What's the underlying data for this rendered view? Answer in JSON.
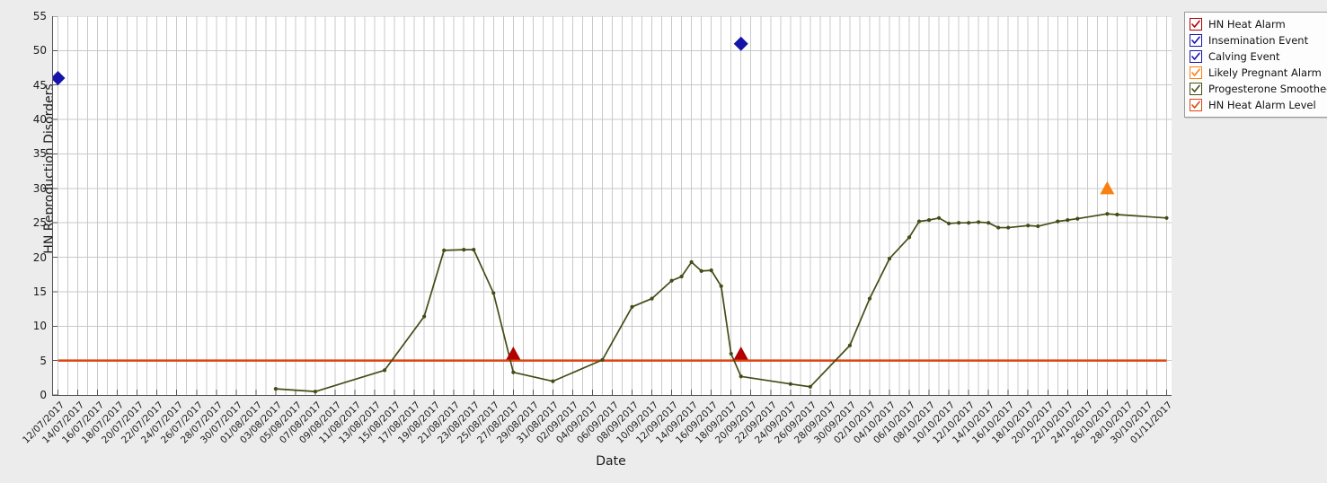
{
  "chart_data": {
    "type": "line",
    "title": "",
    "xlabel": "Date",
    "ylabel": "HN Reproduction Disorders",
    "ylim": [
      0,
      55
    ],
    "ytick_values": [
      0,
      5,
      10,
      15,
      20,
      25,
      30,
      35,
      40,
      45,
      50,
      55
    ],
    "grid": true,
    "legend_position": "right",
    "x_start_date": "12/07/2017",
    "x_end_date": "01/11/2017",
    "x_tick_step_days": 2,
    "xtick_labels": [
      "12/07/2017",
      "14/07/2017",
      "16/07/2017",
      "18/07/2017",
      "20/07/2017",
      "22/07/2017",
      "24/07/2017",
      "26/07/2017",
      "28/07/2017",
      "30/07/2017",
      "01/08/2017",
      "03/08/2017",
      "05/08/2017",
      "07/08/2017",
      "09/08/2017",
      "11/08/2017",
      "13/08/2017",
      "15/08/2017",
      "17/08/2017",
      "19/08/2017",
      "21/08/2017",
      "23/08/2017",
      "25/08/2017",
      "27/08/2017",
      "29/08/2017",
      "31/08/2017",
      "02/09/2017",
      "04/09/2017",
      "06/09/2017",
      "08/09/2017",
      "10/09/2017",
      "12/09/2017",
      "14/09/2017",
      "16/09/2017",
      "18/09/2017",
      "20/09/2017",
      "22/09/2017",
      "24/09/2017",
      "26/09/2017",
      "28/09/2017",
      "30/09/2017",
      "02/10/2017",
      "04/10/2017",
      "06/10/2017",
      "08/10/2017",
      "10/10/2017",
      "12/10/2017",
      "14/10/2017",
      "16/10/2017",
      "18/10/2017",
      "20/10/2017",
      "22/10/2017",
      "24/10/2017",
      "26/10/2017",
      "28/10/2017",
      "30/10/2017",
      "01/11/2017"
    ],
    "series": [
      {
        "name": "Progesterone Smoothed",
        "type": "line",
        "color": "#464b16",
        "marker": "circle",
        "points": [
          {
            "date": "03/08/2017",
            "x": 22,
            "y": 0.9
          },
          {
            "date": "07/08/2017",
            "x": 26,
            "y": 0.5
          },
          {
            "date": "14/08/2017",
            "x": 33,
            "y": 3.6
          },
          {
            "date": "18/08/2017",
            "x": 37,
            "y": 11.4
          },
          {
            "date": "20/08/2017",
            "x": 39,
            "y": 21.0
          },
          {
            "date": "22/08/2017",
            "x": 41,
            "y": 21.1
          },
          {
            "date": "23/08/2017",
            "x": 42,
            "y": 21.1
          },
          {
            "date": "25/08/2017",
            "x": 44,
            "y": 14.8
          },
          {
            "date": "27/08/2017",
            "x": 46,
            "y": 3.3
          },
          {
            "date": "31/08/2017",
            "x": 50,
            "y": 2.0
          },
          {
            "date": "05/09/2017",
            "x": 55,
            "y": 5.1
          },
          {
            "date": "08/09/2017",
            "x": 58,
            "y": 12.8
          },
          {
            "date": "10/09/2017",
            "x": 60,
            "y": 14.0
          },
          {
            "date": "12/09/2017",
            "x": 62,
            "y": 16.6
          },
          {
            "date": "13/09/2017",
            "x": 63,
            "y": 17.2
          },
          {
            "date": "14/09/2017",
            "x": 64,
            "y": 19.3
          },
          {
            "date": "15/09/2017",
            "x": 65,
            "y": 18.0
          },
          {
            "date": "16/09/2017",
            "x": 66,
            "y": 18.1
          },
          {
            "date": "17/09/2017",
            "x": 67,
            "y": 15.8
          },
          {
            "date": "18/09/2017",
            "x": 68,
            "y": 6.0
          },
          {
            "date": "19/09/2017",
            "x": 69,
            "y": 2.7
          },
          {
            "date": "24/09/2017",
            "x": 74,
            "y": 1.6
          },
          {
            "date": "26/09/2017",
            "x": 76,
            "y": 1.2
          },
          {
            "date": "30/09/2017",
            "x": 80,
            "y": 7.2
          },
          {
            "date": "02/10/2017",
            "x": 82,
            "y": 14.0
          },
          {
            "date": "04/10/2017",
            "x": 84,
            "y": 19.8
          },
          {
            "date": "06/10/2017",
            "x": 86,
            "y": 22.9
          },
          {
            "date": "07/10/2017",
            "x": 87,
            "y": 25.2
          },
          {
            "date": "08/10/2017",
            "x": 88,
            "y": 25.4
          },
          {
            "date": "09/10/2017",
            "x": 89,
            "y": 25.7
          },
          {
            "date": "10/10/2017",
            "x": 90,
            "y": 24.9
          },
          {
            "date": "11/10/2017",
            "x": 91,
            "y": 25.0
          },
          {
            "date": "12/10/2017",
            "x": 92,
            "y": 25.0
          },
          {
            "date": "13/10/2017",
            "x": 93,
            "y": 25.1
          },
          {
            "date": "14/10/2017",
            "x": 94,
            "y": 25.0
          },
          {
            "date": "15/10/2017",
            "x": 95,
            "y": 24.3
          },
          {
            "date": "16/10/2017",
            "x": 96,
            "y": 24.3
          },
          {
            "date": "18/10/2017",
            "x": 98,
            "y": 24.6
          },
          {
            "date": "19/10/2017",
            "x": 99,
            "y": 24.5
          },
          {
            "date": "21/10/2017",
            "x": 101,
            "y": 25.2
          },
          {
            "date": "22/10/2017",
            "x": 102,
            "y": 25.4
          },
          {
            "date": "23/10/2017",
            "x": 103,
            "y": 25.6
          },
          {
            "date": "26/10/2017",
            "x": 106,
            "y": 26.3
          },
          {
            "date": "27/10/2017",
            "x": 107,
            "y": 26.2
          },
          {
            "date": "01/11/2017",
            "x": 112,
            "y": 25.7
          }
        ]
      },
      {
        "name": "HN Heat Alarm Level",
        "type": "hline",
        "color": "#dd4411",
        "value": 5
      },
      {
        "name": "HN Heat Alarm",
        "type": "marker",
        "marker": "triangle-up",
        "color": "#b00000",
        "points": [
          {
            "date": "27/08/2017",
            "x": 46,
            "y": 6.0
          },
          {
            "date": "19/09/2017",
            "x": 69,
            "y": 6.0
          }
        ]
      },
      {
        "name": "Insemination Event",
        "type": "marker",
        "marker": "diamond",
        "color": "#1414a8",
        "points": [
          {
            "date": "19/09/2017",
            "x": 69,
            "y": 51.0
          }
        ]
      },
      {
        "name": "Calving Event",
        "type": "marker",
        "marker": "diamond",
        "color": "#1414a8",
        "points": [
          {
            "date": "12/07/2017",
            "x": 0,
            "y": 46.0
          }
        ]
      },
      {
        "name": "Likely Pregnant Alarm",
        "type": "marker",
        "marker": "triangle-up",
        "color": "#f98010",
        "points": [
          {
            "date": "26/10/2017",
            "x": 106,
            "y": 30.0
          }
        ]
      }
    ]
  },
  "legend": {
    "items": [
      {
        "label": "HN Heat Alarm",
        "color": "#b00000",
        "checked": true
      },
      {
        "label": "Insemination Event",
        "color": "#1414a8",
        "checked": true
      },
      {
        "label": "Calving Event",
        "color": "#1414a8",
        "checked": true
      },
      {
        "label": "Likely Pregnant Alarm",
        "color": "#f98010",
        "checked": true
      },
      {
        "label": "Progesterone Smoothed",
        "color": "#464b16",
        "checked": true
      },
      {
        "label": "HN Heat Alarm Level",
        "color": "#dd4411",
        "checked": true
      }
    ]
  },
  "colors": {
    "background": "#ececec",
    "plot_background": "#ffffff",
    "gridline": "#c9c9c9",
    "axis": "#555555",
    "text": "#1a1a1a"
  }
}
